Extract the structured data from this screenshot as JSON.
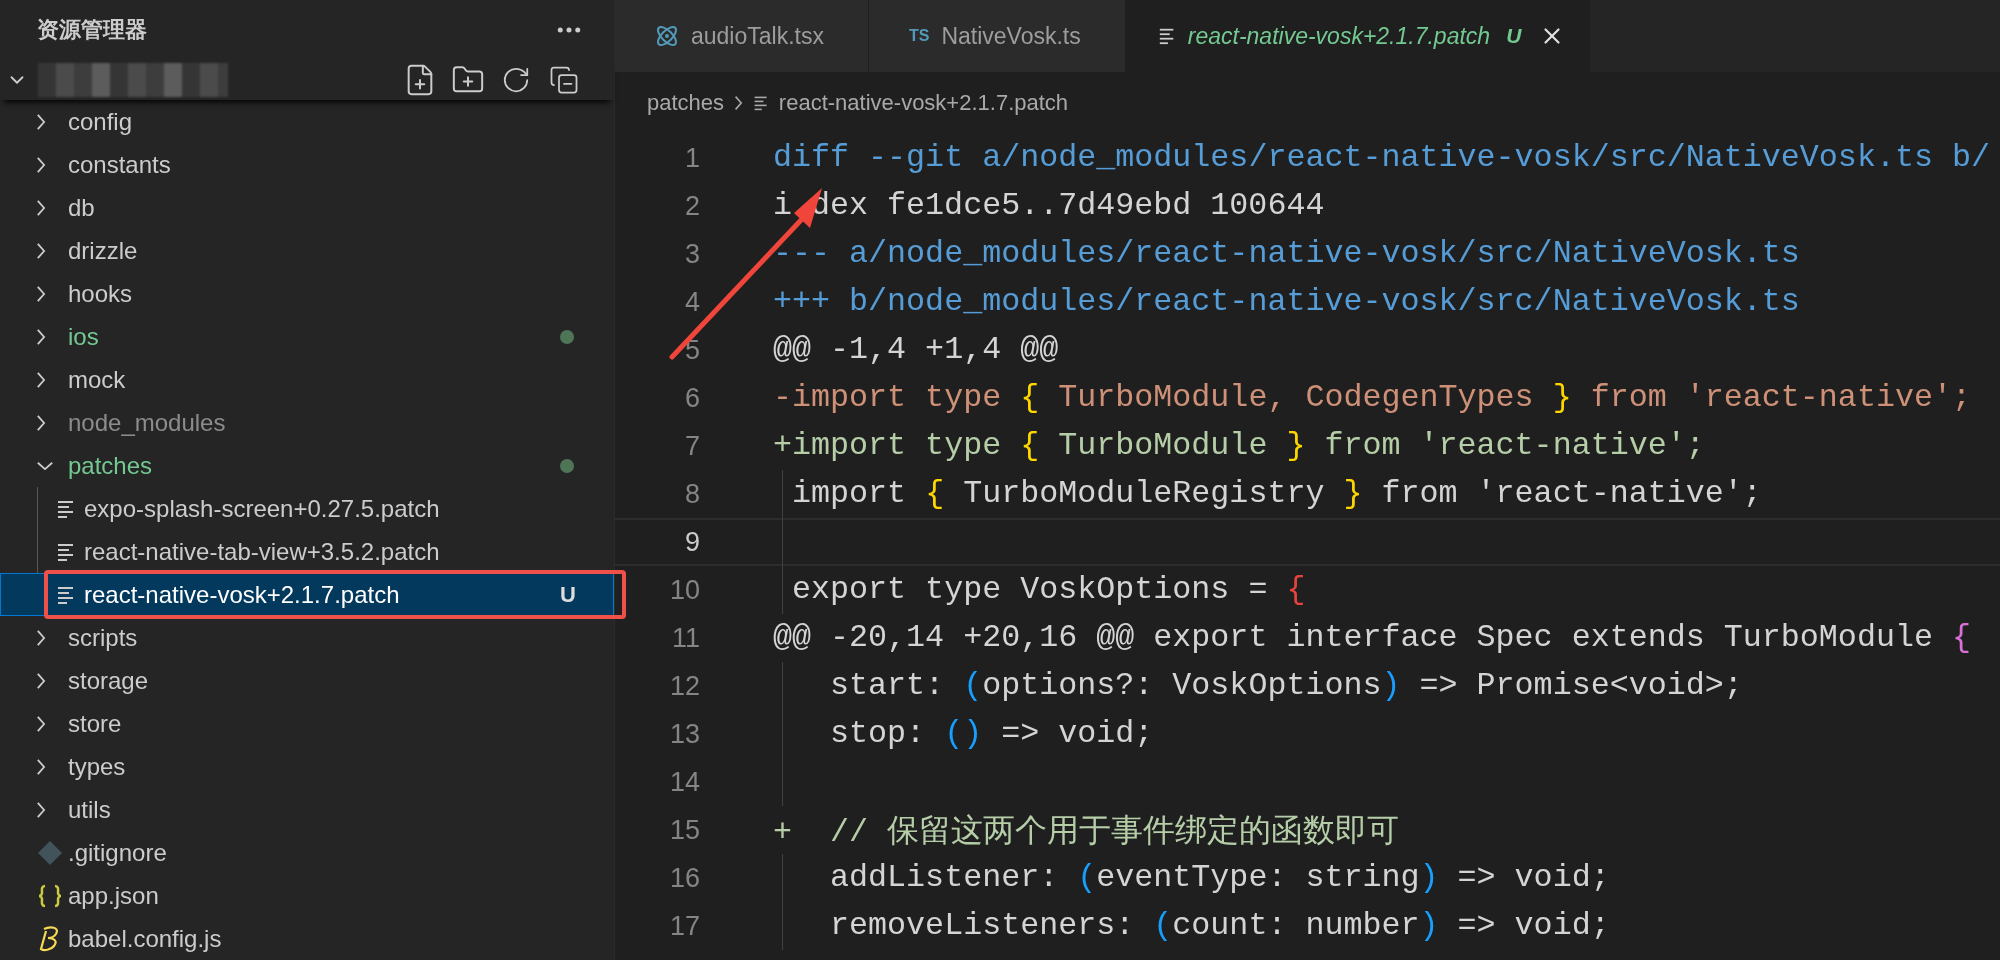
{
  "sidebar": {
    "title": "资源管理器",
    "tree": [
      {
        "name": "config",
        "kind": "folder",
        "expanded": false,
        "untracked": false,
        "ignored": false,
        "selected": false,
        "highlighted": false
      },
      {
        "name": "constants",
        "kind": "folder",
        "expanded": false,
        "untracked": false,
        "ignored": false,
        "selected": false,
        "highlighted": false
      },
      {
        "name": "db",
        "kind": "folder",
        "expanded": false,
        "untracked": false,
        "ignored": false,
        "selected": false,
        "highlighted": false
      },
      {
        "name": "drizzle",
        "kind": "folder",
        "expanded": false,
        "untracked": false,
        "ignored": false,
        "selected": false,
        "highlighted": false
      },
      {
        "name": "hooks",
        "kind": "folder",
        "expanded": false,
        "untracked": false,
        "ignored": false,
        "selected": false,
        "highlighted": false
      },
      {
        "name": "ios",
        "kind": "folder",
        "expanded": false,
        "untracked": true,
        "ignored": false,
        "selected": false,
        "highlighted": false
      },
      {
        "name": "mock",
        "kind": "folder",
        "expanded": false,
        "untracked": false,
        "ignored": false,
        "selected": false,
        "highlighted": false
      },
      {
        "name": "node_modules",
        "kind": "folder",
        "expanded": false,
        "untracked": false,
        "ignored": true,
        "selected": false,
        "highlighted": false
      },
      {
        "name": "patches",
        "kind": "folder",
        "expanded": true,
        "untracked": true,
        "ignored": false,
        "selected": false,
        "highlighted": false,
        "children": [
          {
            "name": "expo-splash-screen+0.27.5.patch",
            "kind": "patch",
            "untracked": false,
            "ignored": false,
            "selected": false,
            "highlighted": false
          },
          {
            "name": "react-native-tab-view+3.5.2.patch",
            "kind": "patch",
            "untracked": false,
            "ignored": false,
            "selected": false,
            "highlighted": false
          },
          {
            "name": "react-native-vosk+2.1.7.patch",
            "kind": "patch",
            "untracked": true,
            "ignored": false,
            "badge": "U",
            "selected": true,
            "highlighted": true
          }
        ]
      },
      {
        "name": "scripts",
        "kind": "folder",
        "expanded": false,
        "untracked": false,
        "ignored": false,
        "selected": false,
        "highlighted": false
      },
      {
        "name": "storage",
        "kind": "folder",
        "expanded": false,
        "untracked": false,
        "ignored": false,
        "selected": false,
        "highlighted": false
      },
      {
        "name": "store",
        "kind": "folder",
        "expanded": false,
        "untracked": false,
        "ignored": false,
        "selected": false,
        "highlighted": false
      },
      {
        "name": "types",
        "kind": "folder",
        "expanded": false,
        "untracked": false,
        "ignored": false,
        "selected": false,
        "highlighted": false
      },
      {
        "name": "utils",
        "kind": "folder",
        "expanded": false,
        "untracked": false,
        "ignored": false,
        "selected": false,
        "highlighted": false
      },
      {
        "name": ".gitignore",
        "kind": "gitignore",
        "untracked": false,
        "ignored": false,
        "selected": false,
        "highlighted": false
      },
      {
        "name": "app.json",
        "kind": "json",
        "untracked": false,
        "ignored": false,
        "selected": false,
        "highlighted": false
      },
      {
        "name": "babel.config.js",
        "kind": "babel",
        "untracked": false,
        "ignored": false,
        "selected": false,
        "highlighted": false
      }
    ]
  },
  "tabs": [
    {
      "label": "audioTalk.tsx",
      "kind": "tsx",
      "selected": false
    },
    {
      "label": "NativeVosk.ts",
      "kind": "ts",
      "icon_text": "TS",
      "selected": false
    },
    {
      "label": "react-native-vosk+2.1.7.patch",
      "kind": "patch",
      "badge": "U",
      "selected": true
    }
  ],
  "breadcrumbs": [
    {
      "label": "patches",
      "kind": "folder"
    },
    {
      "label": "react-native-vosk+2.1.7.patch",
      "kind": "patch"
    }
  ],
  "code": [
    {
      "number": "1",
      "current": false,
      "tokens": [
        {
          "text": "diff --git a/node_modules/react-native-vosk/src/NativeVosk.ts b/",
          "kind": "header"
        }
      ]
    },
    {
      "number": "2",
      "current": false,
      "tokens": [
        {
          "text": "i",
          "kind": "plain"
        },
        {
          "text": "dex fe1dce5..7d49ebd 100644",
          "kind": "plain",
          "after_covered": true
        }
      ]
    },
    {
      "number": "3",
      "current": false,
      "tokens": [
        {
          "text": "--- a/node_modules/react-native-vosk/src/NativeVosk.ts",
          "kind": "header"
        }
      ]
    },
    {
      "number": "4",
      "current": false,
      "tokens": [
        {
          "text": "+++ b/node_modules/react-native-vosk/src/NativeVosk.ts",
          "kind": "header"
        }
      ]
    },
    {
      "number": "5",
      "current": false,
      "tokens": [
        {
          "text": "@@ -1,4 +1,4 @@",
          "kind": "plain"
        }
      ]
    },
    {
      "number": "6",
      "current": false,
      "tokens": [
        {
          "text": "-import type ",
          "kind": "removed"
        },
        {
          "text": "{",
          "kind": "brace"
        },
        {
          "text": " TurboModule, CodegenTypes ",
          "kind": "removed"
        },
        {
          "text": "}",
          "kind": "brace"
        },
        {
          "text": " from 'react-native';",
          "kind": "removed"
        }
      ]
    },
    {
      "number": "7",
      "current": false,
      "tokens": [
        {
          "text": "+import type ",
          "kind": "added"
        },
        {
          "text": "{",
          "kind": "brace"
        },
        {
          "text": " TurboModule ",
          "kind": "added"
        },
        {
          "text": "}",
          "kind": "brace"
        },
        {
          "text": " from 'react-native';",
          "kind": "added"
        }
      ]
    },
    {
      "number": "8",
      "current": false,
      "tokens": [
        {
          "text": " import ",
          "kind": "plain"
        },
        {
          "text": "{",
          "kind": "brace"
        },
        {
          "text": " TurboModuleRegistry ",
          "kind": "plain"
        },
        {
          "text": "}",
          "kind": "brace"
        },
        {
          "text": " from 'react-native';",
          "kind": "plain"
        }
      ]
    },
    {
      "number": "9",
      "current": true
    },
    {
      "number": "10",
      "current": false,
      "tokens": [
        {
          "text": " export type VoskOptions = ",
          "kind": "plain"
        },
        {
          "text": "{",
          "kind": "brace-red"
        }
      ]
    },
    {
      "number": "11",
      "current": false,
      "tokens": [
        {
          "text": "@@ -20,14 +20,16 @@ export interface Spec extends TurboModule ",
          "kind": "plain"
        },
        {
          "text": "{",
          "kind": "brace-pink"
        }
      ]
    },
    {
      "number": "12",
      "current": false,
      "tokens": [
        {
          "text": "   start: ",
          "kind": "plain"
        },
        {
          "text": "(",
          "kind": "paren"
        },
        {
          "text": "options?: VoskOptions",
          "kind": "plain"
        },
        {
          "text": ")",
          "kind": "paren"
        },
        {
          "text": " => Promise<void>;",
          "kind": "plain"
        }
      ]
    },
    {
      "number": "13",
      "current": false,
      "tokens": [
        {
          "text": "   stop: ",
          "kind": "plain"
        },
        {
          "text": "()",
          "kind": "paren"
        },
        {
          "text": " => void;",
          "kind": "plain"
        }
      ]
    },
    {
      "number": "14",
      "current": false
    },
    {
      "number": "15",
      "current": false,
      "tokens": [
        {
          "text": "+  // 保留这两个用于事件绑定的函数即可",
          "kind": "added"
        }
      ]
    },
    {
      "number": "16",
      "current": false,
      "tokens": [
        {
          "text": "   addListener: ",
          "kind": "plain"
        },
        {
          "text": "(",
          "kind": "paren"
        },
        {
          "text": "eventType: string",
          "kind": "plain"
        },
        {
          "text": ")",
          "kind": "paren"
        },
        {
          "text": " => void;",
          "kind": "plain"
        }
      ]
    },
    {
      "number": "17",
      "current": false,
      "tokens": [
        {
          "text": "   removeListeners: ",
          "kind": "plain"
        },
        {
          "text": "(",
          "kind": "paren"
        },
        {
          "text": "count: number",
          "kind": "plain"
        },
        {
          "text": ")",
          "kind": "paren"
        },
        {
          "text": " => void;",
          "kind": "plain"
        }
      ]
    }
  ]
}
